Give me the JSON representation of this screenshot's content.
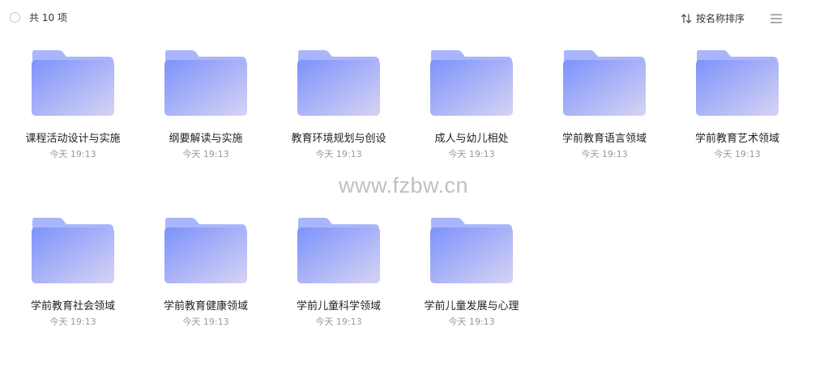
{
  "toolbar": {
    "count_label": "共 10 项",
    "sort_label": "按名称排序",
    "icons": {
      "select_all": "circle-checkbox-icon",
      "sort": "sort-arrows-icon",
      "view": "list-view-icon"
    }
  },
  "colors": {
    "folder_front_start": "#7d93fb",
    "folder_front_end": "#d6d3f3",
    "folder_back": "#aab6fb",
    "text_primary": "#222222",
    "text_secondary": "#999999"
  },
  "items": [
    {
      "name": "课程活动设计与实施",
      "time": "今天 19:13"
    },
    {
      "name": "纲要解读与实施",
      "time": "今天 19:13"
    },
    {
      "name": "教育环境规划与创设",
      "time": "今天 19:13"
    },
    {
      "name": "成人与幼儿相处",
      "time": "今天 19:13"
    },
    {
      "name": "学前教育语言领域",
      "time": "今天 19:13"
    },
    {
      "name": "学前教育艺术领域",
      "time": "今天 19:13"
    },
    {
      "name": "学前教育社会领域",
      "time": "今天 19:13"
    },
    {
      "name": "学前教育健康领域",
      "time": "今天 19:13"
    },
    {
      "name": "学前儿童科学领域",
      "time": "今天 19:13"
    },
    {
      "name": "学前儿童发展与心理",
      "time": "今天 19:13"
    }
  ],
  "watermark": "www.fzbw.cn"
}
